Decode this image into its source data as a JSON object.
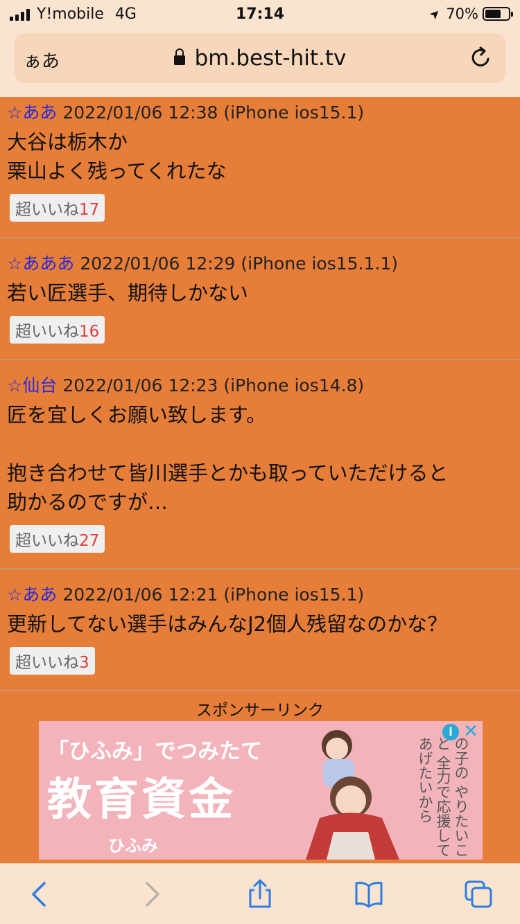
{
  "status_bar": {
    "carrier": "Y!mobile",
    "network": "4G",
    "time": "17:14",
    "battery_percent": "70%",
    "battery_level": 0.7
  },
  "address_bar": {
    "aa_label": "ぁあ",
    "url": "bm.best-hit.tv"
  },
  "posts": [
    {
      "name": "☆ああ",
      "meta": " 2022/01/06 12:38 (iPhone ios15.1)",
      "body": "大谷は栃木か\n栗山よく残ってくれたな",
      "like_label": "超いいね",
      "like_count": "17"
    },
    {
      "name": "☆あああ",
      "meta": " 2022/01/06 12:29 (iPhone ios15.1.1)",
      "body": "若い匠選手、期待しかない",
      "like_label": "超いいね",
      "like_count": "16"
    },
    {
      "name": "☆仙台",
      "meta": " 2022/01/06 12:23 (iPhone ios14.8)",
      "body": "匠を宜しくお願い致します。\n\n抱き合わせて皆川選手とかも取っていただけると\n助かるのですが…",
      "like_label": "超いいね",
      "like_count": "27"
    },
    {
      "name": "☆ああ",
      "meta": " 2022/01/06 12:21 (iPhone ios15.1)",
      "body": "更新してない選手はみんなJ2個人残留なのかな？",
      "like_label": "超いいね",
      "like_count": "3"
    }
  ],
  "sponsor": {
    "label": "スポンサーリンク",
    "ad_line1": "「ひふみ」でつみたて",
    "ad_line2": "教育資金",
    "ad_brand": "ひふみ",
    "ad_copy": "の子の\nやりたいこと\n全力で応援して\nあげたいから"
  },
  "icons": {
    "back": "chevron-left-icon",
    "forward": "chevron-right-icon",
    "share": "share-icon",
    "bookmarks": "book-icon",
    "tabs": "tabs-icon",
    "reload": "reload-icon",
    "lock": "lock-icon"
  },
  "colors": {
    "page_background": "#e67e3a",
    "browser_chrome": "#fbe4cf",
    "name_link": "#2a2ad6",
    "like_count": "#e03d3d",
    "toolbar_active": "#2a7de1"
  }
}
